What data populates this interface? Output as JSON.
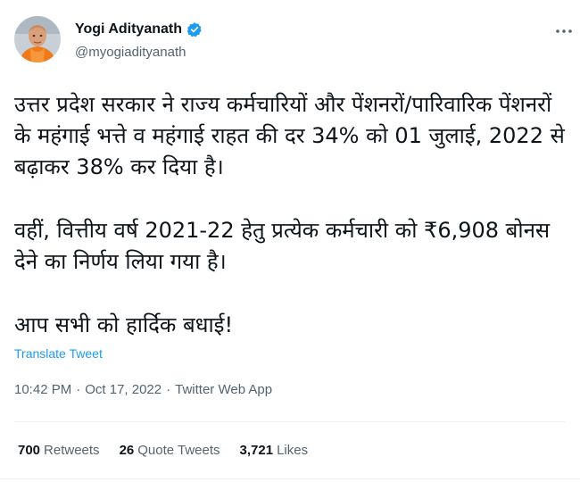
{
  "author": {
    "name": "Yogi Adityanath",
    "handle": "@myogiadityanath",
    "verified": true
  },
  "tweet": {
    "paragraphs": [
      "उत्तर प्रदेश सरकार ने राज्य कर्मचारियों और पेंशनरों/पारिवारिक पेंशनरों के महंगाई भत्ते व महंगाई राहत की दर 34% को 01 जुलाई, 2022 से बढ़ाकर 38% कर दिया है।",
      "वहीं, वित्तीय वर्ष 2021-22 हेतु प्रत्येक कर्मचारी को ₹6,908 बोनस देने का निर्णय लिया गया है।",
      "आप सभी को हार्दिक बधाई!"
    ],
    "translate_label": "Translate Tweet",
    "time": "10:42 PM",
    "date": "Oct 17, 2022",
    "source": "Twitter Web App",
    "separator": "·"
  },
  "stats": {
    "retweets_count": "700",
    "retweets_label": "Retweets",
    "quotes_count": "26",
    "quotes_label": "Quote Tweets",
    "likes_count": "3,721",
    "likes_label": "Likes"
  },
  "icons": {
    "more": "more-horizontal-icon",
    "verified": "verified-badge-icon"
  },
  "colors": {
    "accent": "#1d9bf0",
    "secondary_text": "#536471",
    "primary_text": "#0f1419",
    "avatar_robe": "#f07a1a"
  }
}
